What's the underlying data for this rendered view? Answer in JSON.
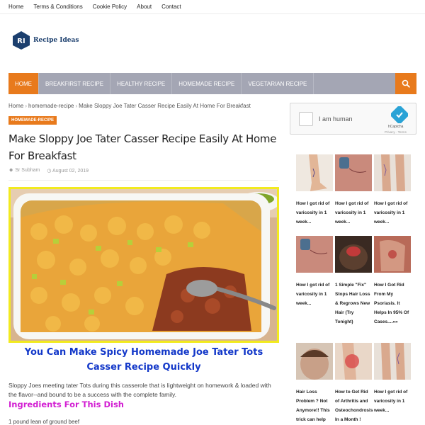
{
  "topbar": {
    "links": [
      "Home",
      "Terms & Conditions",
      "Cookie Policy",
      "About",
      "Contact"
    ]
  },
  "logo": {
    "letters": "RI",
    "text": "Recipe Ideas"
  },
  "nav": {
    "items": [
      "Home",
      "Breakfirst Recipe",
      "Healthy Recipe",
      "Homemade Recipe",
      "Vegetarian Recipe"
    ],
    "active_index": 0,
    "search_icon": "search-icon",
    "accent": "#e87a1c",
    "bar_color": "#a4a6b4"
  },
  "breadcrumb": {
    "items": [
      "Home",
      "homemade-recipe",
      "Make Sloppy Joe Tater Casser Recipe Easily At Home For Breakfast"
    ],
    "separator": "›"
  },
  "post": {
    "tag": "Homemade-Recipe",
    "title": "Make Sloppy Joe Tater Casser Recipe Easily At Home For Breakfast",
    "author": "Sr Subham",
    "date": "August 02, 2019",
    "subhead": "You Can Make Spicy Homemade Joe Tater Tots Casser Recipe Quickly",
    "intro": "Sloppy Joes meeting tater Tots during this casserole that is lightweight on homework & loaded with the flavor--and bound to be a success with the complete family.",
    "ingredients_heading": "Ingredients For This Dish",
    "first_ingredient": "1 pound lean of ground beef"
  },
  "captcha": {
    "label": "I am human",
    "brand": "hCaptcha",
    "links": "Privacy · Terms"
  },
  "sidebar_ads": [
    {
      "caption": "How I got rid of varicosity in 1 week..."
    },
    {
      "caption": "How I got rid of varicosity in 1 week..."
    },
    {
      "caption": "How I got rid of varicosity in 1 week..."
    },
    {
      "caption": "How I got rid of varicosity in 1 week..."
    },
    {
      "caption": "1 Simple \"Fix\" Stops Hair Loss & Regrows New Hair (Try Tonight)"
    },
    {
      "caption": "How I Got Rid From My Psoriasis. It Helps In 95% Of Cases....»»"
    },
    {
      "caption": "Hair Loss Problem ? Not Anymore!! This trick can help you!"
    },
    {
      "caption": "How to Get Rid of Arthritis and Osteochondrosis In a Month !"
    },
    {
      "caption": "How I got rid of varicosity in 1 week..."
    }
  ]
}
